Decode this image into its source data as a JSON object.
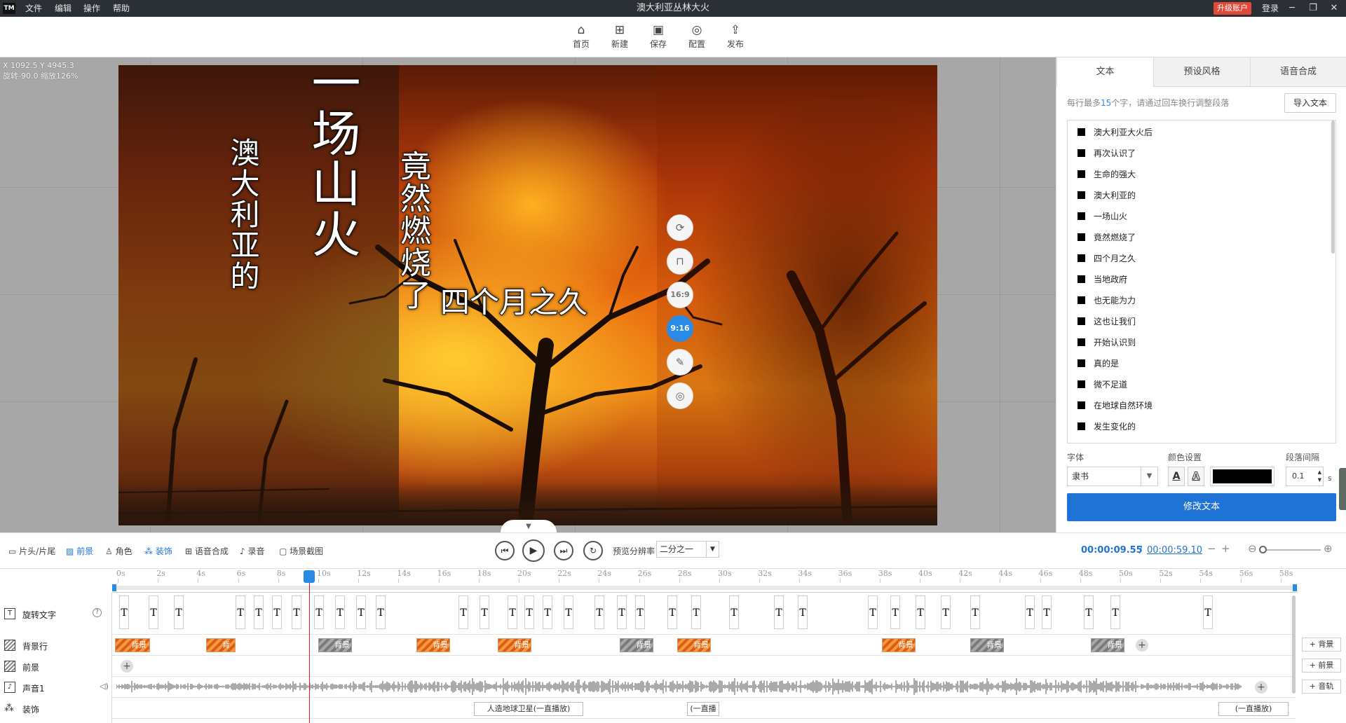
{
  "titlebar": {
    "logo": "TM",
    "menu": [
      "文件",
      "编辑",
      "操作",
      "帮助"
    ],
    "title": "澳大利亚丛林大火",
    "upgrade": "升级账户",
    "login": "登录",
    "window_buttons": [
      "minimize-icon",
      "restore-icon",
      "close-icon"
    ]
  },
  "toolbar": {
    "items": [
      {
        "label": "首页",
        "icon": "home-icon"
      },
      {
        "label": "新建",
        "icon": "new-icon"
      },
      {
        "label": "保存",
        "icon": "save-icon"
      },
      {
        "label": "配置",
        "icon": "settings-icon"
      },
      {
        "label": "发布",
        "icon": "publish-icon"
      }
    ]
  },
  "canvas": {
    "coord": "X 1092.5 Y 4945.3",
    "rotate_zoom": "旋转-90.0 缩放126%",
    "texts": {
      "t1": "澳大利亚的",
      "t2": "一场山火",
      "t3": "竟然燃烧了",
      "t4": "四个月之久"
    },
    "side_buttons": [
      {
        "icon": "rotate-icon"
      },
      {
        "icon": "unlock-icon"
      },
      {
        "label": "16:9"
      },
      {
        "label": "9:16",
        "active": true
      },
      {
        "icon": "edit-icon"
      },
      {
        "icon": "target-icon"
      }
    ]
  },
  "right_panel": {
    "tabs": [
      "文本",
      "预设风格",
      "语音合成"
    ],
    "active_tab": 0,
    "hint_prefix": "每行最多",
    "hint_number": "15",
    "hint_suffix": "个字，请通过回车换行调整段落",
    "import_button": "导入文本",
    "lines": [
      "澳大利亚大火后",
      "再次认识了",
      "生命的强大",
      "澳大利亚的",
      "一场山火",
      "竟然燃烧了",
      "四个月之久",
      "当地政府",
      "也无能为力",
      "这也让我们",
      "开始认识到",
      "真的是",
      "微不足道",
      "在地球自然环境",
      "发生变化的"
    ],
    "font_label": "字体",
    "font_value": "隶书",
    "color_label": "颜色设置",
    "color_value": "#000000",
    "spacing_label": "段落间隔",
    "spacing_value": "0.1",
    "spacing_unit": "s",
    "modify_button": "修改文本"
  },
  "timeline_bar": {
    "tools": [
      "片头/片尾",
      "前景",
      "角色",
      "装饰",
      "语音合成",
      "录音",
      "场景截图"
    ],
    "preview_label": "预览分辨率",
    "preview_value": "二分之一",
    "current_time": "00:00:09.55",
    "separator": "/",
    "total_time": "00:00:59.10"
  },
  "ruler": {
    "ticks": [
      "0s",
      "2s",
      "4s",
      "6s",
      "8s",
      "10s",
      "12s",
      "14s",
      "16s",
      "18s",
      "20s",
      "22s",
      "24s",
      "26s",
      "28s",
      "30s",
      "32s",
      "34s",
      "36s",
      "38s",
      "40s",
      "42s",
      "44s",
      "46s",
      "48s",
      "50s",
      "52s",
      "54s",
      "56s",
      "58s"
    ],
    "playhead_s": 9.55
  },
  "tracks": {
    "rotate_text": "旋转文字",
    "background": "背景行",
    "foreground": "前景",
    "audio": "声音1",
    "decoration": "装饰",
    "text_chip": "T",
    "bg_label": "背景",
    "add_bg": "+ 背景",
    "add_fg": "+ 前景",
    "add_audio": "+ 音轨",
    "decos": [
      "人造地球卫星(一直播放)",
      "(一直播",
      "(一直播放)"
    ]
  }
}
